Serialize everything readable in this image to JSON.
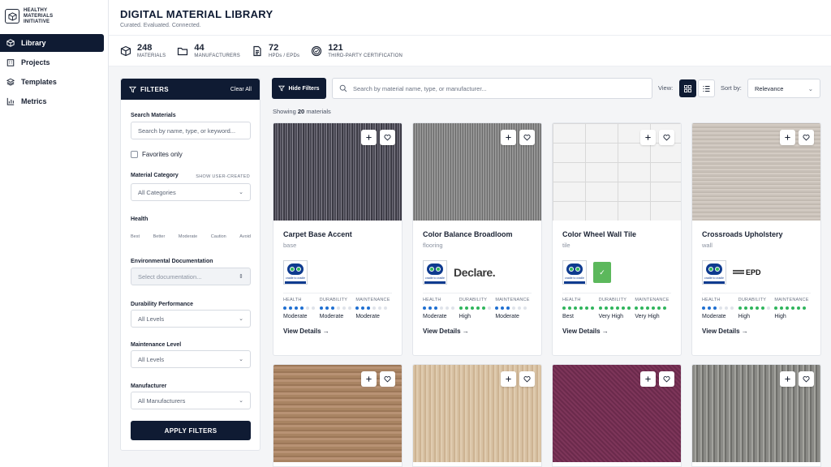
{
  "brand": {
    "line1": "HEALTHY",
    "line2": "MATERIALS",
    "line3": "INITIATIVE"
  },
  "nav": [
    {
      "label": "Library",
      "icon": "cube-icon",
      "active": true
    },
    {
      "label": "Projects",
      "icon": "building-icon",
      "active": false
    },
    {
      "label": "Templates",
      "icon": "layers-icon",
      "active": false
    },
    {
      "label": "Metrics",
      "icon": "bar-chart-icon",
      "active": false
    }
  ],
  "header": {
    "title": "DIGITAL MATERIAL LIBRARY",
    "subtitle": "Curated. Evaluated. Connected."
  },
  "stats": [
    {
      "num": "248",
      "label": "MATERIALS",
      "icon": "cube-icon"
    },
    {
      "num": "44",
      "label": "MANUFACTURERS",
      "icon": "folder-icon"
    },
    {
      "num": "72",
      "label": "HPDs / EPDs",
      "icon": "document-icon"
    },
    {
      "num": "121",
      "label": "THIRD-PARTY CERTIFICATION",
      "icon": "badge-icon"
    }
  ],
  "filters": {
    "title": "FILTERS",
    "clear": "Clear All",
    "search_label": "Search Materials",
    "search_placeholder": "Search by name, type, or keyword...",
    "favorites": "Favorites only",
    "category_label": "Material Category",
    "show_user_created": "SHOW USER-CREATED",
    "category_value": "All Categories",
    "health_label": "Health",
    "health_scale": [
      "Best",
      "Better",
      "Moderate",
      "Caution",
      "Avoid"
    ],
    "env_label": "Environmental Documentation",
    "env_value": "Select documentation...",
    "durability_label": "Durability Performance",
    "durability_value": "All Levels",
    "maintenance_label": "Maintenance Level",
    "maintenance_value": "All Levels",
    "manufacturer_label": "Manufacturer",
    "manufacturer_value": "All Manufacturers",
    "apply": "APPLY FILTERS"
  },
  "toolbar": {
    "hide_filters": "Hide Filters",
    "search_placeholder": "Search by material name, type, or manufacturer...",
    "view_label": "View:",
    "sort_label": "Sort by:",
    "sort_value": "Relevance",
    "showing_prefix": "Showing",
    "showing_count": "20",
    "showing_suffix": "materials"
  },
  "metric_labels": {
    "health": "HEALTH",
    "durability": "DURABILITY",
    "maintenance": "MAINTENANCE"
  },
  "view_details": "View Details →",
  "colors": {
    "navy": "#0f1b33",
    "blue_dot": "#1f6fd1",
    "green_dot": "#2fb55c"
  },
  "cards": [
    {
      "name": "Carpet Base Accent",
      "category": "base",
      "texture": "carpet",
      "certs": [
        "c2c"
      ],
      "c2c_text": "cradle to cradle",
      "health": "Moderate",
      "durability": "Moderate",
      "maintenance": "Moderate",
      "health_level": 4,
      "durability_level": 3,
      "maintenance_level": 3,
      "health_color": "blue",
      "durability_color": "blue",
      "maintenance_color": "blue"
    },
    {
      "name": "Color Balance Broadloom",
      "category": "flooring",
      "texture": "broadloom",
      "certs": [
        "c2c",
        "declare"
      ],
      "c2c_text": "cradle to cradle",
      "declare_text": "Declare.",
      "health": "Moderate",
      "durability": "High",
      "maintenance": "Moderate",
      "health_level": 3,
      "durability_level": 5,
      "maintenance_level": 3,
      "health_color": "blue",
      "durability_color": "green",
      "maintenance_color": "blue"
    },
    {
      "name": "Color Wheel Wall Tile",
      "category": "tile",
      "texture": "tile",
      "certs": [
        "c2c",
        "green"
      ],
      "c2c_text": "cradle to cradle",
      "green_text": "✓",
      "health": "Best",
      "durability": "Very High",
      "maintenance": "Very High",
      "health_level": 6,
      "durability_level": 6,
      "maintenance_level": 6,
      "health_color": "green",
      "durability_color": "green",
      "maintenance_color": "green"
    },
    {
      "name": "Crossroads Upholstery",
      "category": "wall",
      "texture": "uph",
      "certs": [
        "c2c",
        "epd"
      ],
      "c2c_text": "cradle to cradle",
      "epd_text": "EPD",
      "health": "Moderate",
      "durability": "High",
      "maintenance": "High",
      "health_level": 3,
      "durability_level": 5,
      "maintenance_level": 6,
      "health_color": "blue",
      "durability_color": "green",
      "maintenance_color": "green"
    }
  ],
  "cards_row2": [
    {
      "texture": "wood1"
    },
    {
      "texture": "wood2"
    },
    {
      "texture": "purple"
    },
    {
      "texture": "stone"
    }
  ]
}
